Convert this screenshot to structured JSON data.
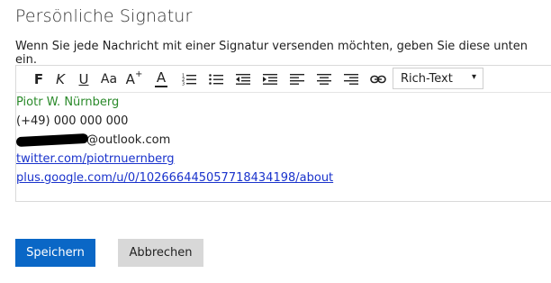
{
  "page": {
    "title": "Persönliche Signatur",
    "description": "Wenn Sie jede Nachricht mit einer Signatur versenden möchten, geben Sie diese unten ein."
  },
  "toolbar": {
    "bold": "F",
    "italic": "K",
    "underline": "U",
    "font_size": "Aa",
    "grow_font": "A",
    "grow_font_superscript": "+",
    "font_color": "A",
    "format_select": "Rich-Text",
    "format_caret": "▾",
    "icons": [
      "bold-icon",
      "italic-icon",
      "underline-icon",
      "font-size-icon",
      "grow-font-icon",
      "font-color-icon",
      "numbered-list-icon",
      "bulleted-list-icon",
      "decrease-indent-icon",
      "increase-indent-icon",
      "align-left-icon",
      "align-center-icon",
      "align-right-icon",
      "link-icon"
    ]
  },
  "signature": {
    "name": "Piotr W. Nürnberg",
    "phone": "(+49) 000 000 000",
    "email_suffix": "@outlook.com",
    "twitter": "twitter.com/piotrnuernberg",
    "google": "plus.google.com/u/0/102666445057718434198/about"
  },
  "buttons": {
    "save": "Speichern",
    "cancel": "Abbrechen"
  },
  "colors": {
    "accent": "#0a67c6",
    "name_green": "#2a8a2a",
    "link_blue": "#1a33cc"
  }
}
